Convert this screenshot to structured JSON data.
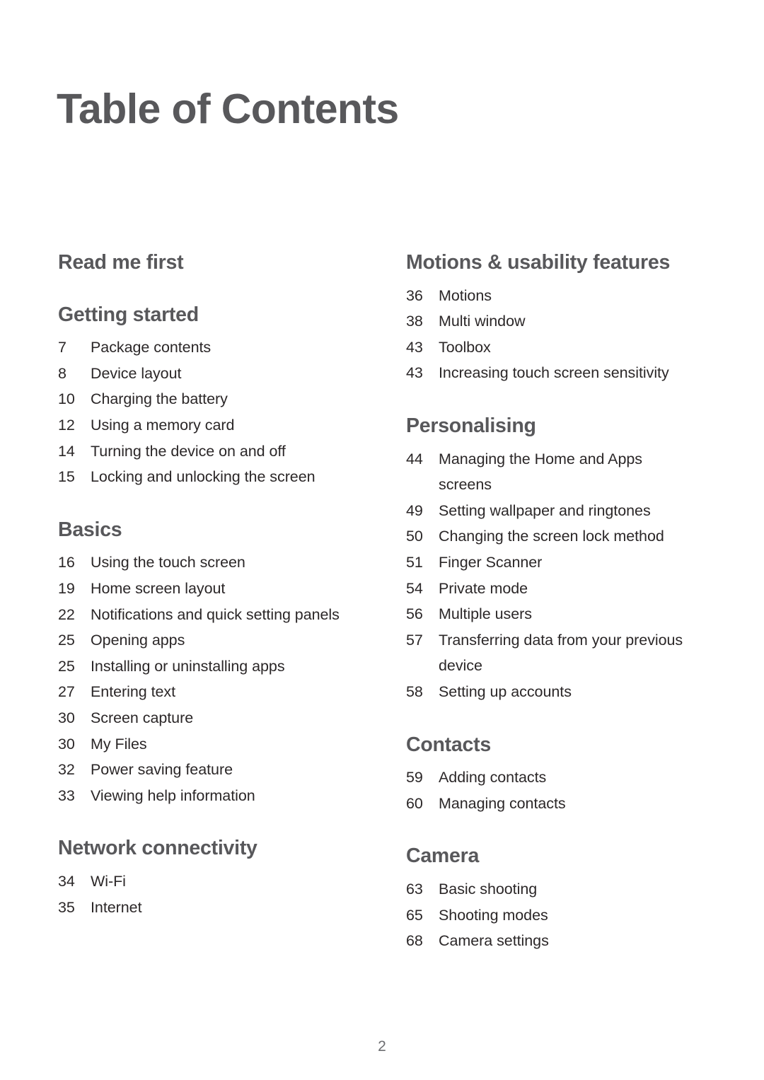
{
  "document": {
    "title": "Table of Contents",
    "page_number": "2",
    "colors": {
      "heading": "#58585b",
      "body": "#2b2728",
      "page_number": "#6d6e71",
      "background": "#ffffff"
    }
  },
  "columns": {
    "left": [
      {
        "heading": "Read me first",
        "entries": []
      },
      {
        "heading": "Getting started",
        "entries": [
          {
            "page": "7",
            "title": "Package contents"
          },
          {
            "page": "8",
            "title": "Device layout"
          },
          {
            "page": "10",
            "title": "Charging the battery"
          },
          {
            "page": "12",
            "title": "Using a memory card"
          },
          {
            "page": "14",
            "title": "Turning the device on and off"
          },
          {
            "page": "15",
            "title": "Locking and unlocking the screen"
          }
        ]
      },
      {
        "heading": "Basics",
        "entries": [
          {
            "page": "16",
            "title": "Using the touch screen"
          },
          {
            "page": "19",
            "title": "Home screen layout"
          },
          {
            "page": "22",
            "title": "Notifications and quick setting panels"
          },
          {
            "page": "25",
            "title": "Opening apps"
          },
          {
            "page": "25",
            "title": "Installing or uninstalling apps"
          },
          {
            "page": "27",
            "title": "Entering text"
          },
          {
            "page": "30",
            "title": "Screen capture"
          },
          {
            "page": "30",
            "title": "My Files"
          },
          {
            "page": "32",
            "title": "Power saving feature"
          },
          {
            "page": "33",
            "title": "Viewing help information"
          }
        ]
      },
      {
        "heading": "Network connectivity",
        "entries": [
          {
            "page": "34",
            "title": "Wi-Fi"
          },
          {
            "page": "35",
            "title": "Internet"
          }
        ]
      }
    ],
    "right": [
      {
        "heading": "Motions & usability features",
        "entries": [
          {
            "page": "36",
            "title": "Motions"
          },
          {
            "page": "38",
            "title": "Multi window"
          },
          {
            "page": "43",
            "title": "Toolbox"
          },
          {
            "page": "43",
            "title": "Increasing touch screen sensitivity"
          }
        ]
      },
      {
        "heading": "Personalising",
        "entries": [
          {
            "page": "44",
            "title": "Managing the Home and Apps screens"
          },
          {
            "page": "49",
            "title": "Setting wallpaper and ringtones"
          },
          {
            "page": "50",
            "title": "Changing the screen lock method"
          },
          {
            "page": "51",
            "title": "Finger Scanner"
          },
          {
            "page": "54",
            "title": "Private mode"
          },
          {
            "page": "56",
            "title": "Multiple users"
          },
          {
            "page": "57",
            "title": "Transferring data from your previous device"
          },
          {
            "page": "58",
            "title": "Setting up accounts"
          }
        ]
      },
      {
        "heading": "Contacts",
        "entries": [
          {
            "page": "59",
            "title": "Adding contacts"
          },
          {
            "page": "60",
            "title": "Managing contacts"
          }
        ]
      },
      {
        "heading": "Camera",
        "entries": [
          {
            "page": "63",
            "title": "Basic shooting"
          },
          {
            "page": "65",
            "title": "Shooting modes"
          },
          {
            "page": "68",
            "title": "Camera settings"
          }
        ]
      }
    ]
  }
}
